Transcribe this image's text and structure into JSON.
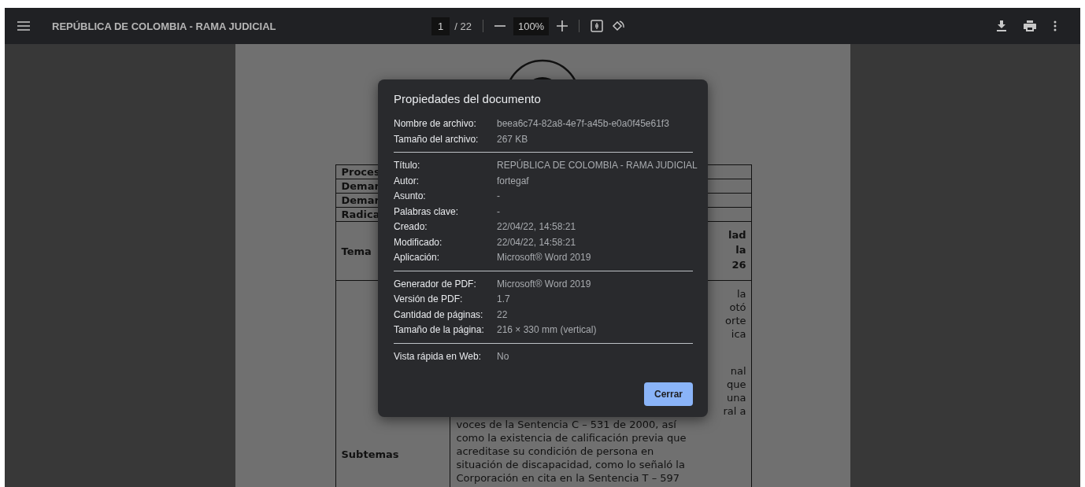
{
  "toolbar": {
    "title": "REPÚBLICA DE COLOMBIA - RAMA JUDICIAL",
    "page_input": "1",
    "page_total": "/ 22",
    "zoom": "100%"
  },
  "document": {
    "rows": [
      {
        "label": "Proces"
      },
      {
        "label": "Demar"
      },
      {
        "label": "Demar"
      },
      {
        "label": "Radica"
      },
      {
        "label": "Tema",
        "bold": true,
        "paragraphs": [
          [
            {
              "kind": "fragment",
              "text": "lad"
            },
            {
              "kind": "fragment",
              "text": "la"
            },
            {
              "kind": "fragment",
              "text": "26"
            }
          ]
        ]
      },
      {
        "label": "Subtemas",
        "bold": false,
        "paragraphs": [
          [
            {
              "kind": "fragment",
              "text": "la"
            },
            {
              "kind": "fragment",
              "text": "otó"
            },
            {
              "kind": "fragment",
              "text": "orte"
            },
            {
              "kind": "fragment",
              "text": "ica"
            }
          ],
          [
            {
              "kind": "fragment",
              "text": "nal"
            },
            {
              "kind": "fragment",
              "text": "que"
            },
            {
              "kind": "fragment",
              "text": "una"
            },
            {
              "kind": "fragment",
              "text": "ral a"
            },
            {
              "kind": "line",
              "text": "voces de la Sentencia C – 531 de 2000, así"
            },
            {
              "kind": "line",
              "text": "como la existencia de calificación previa que"
            },
            {
              "kind": "line",
              "text": "acreditase su condición de persona en"
            },
            {
              "kind": "line",
              "text": "situación de discapacidad, como lo señaló la"
            },
            {
              "kind": "line",
              "text": "Corporación en cita en la Sentencia T – 597"
            }
          ]
        ]
      }
    ]
  },
  "dialog": {
    "title": "Propiedades del documento",
    "sections": [
      [
        {
          "label": "Nombre de archivo:",
          "value": "beea6c74-82a8-4e7f-a45b-e0a0f45e61f3"
        },
        {
          "label": "Tamaño del archivo:",
          "value": "267 KB"
        }
      ],
      [
        {
          "label": "Título:",
          "value": "REPÚBLICA DE COLOMBIA - RAMA JUDICIAL"
        },
        {
          "label": "Autor:",
          "value": "fortegaf"
        },
        {
          "label": "Asunto:",
          "value": "-"
        },
        {
          "label": "Palabras clave:",
          "value": "-"
        },
        {
          "label": "Creado:",
          "value": "22/04/22, 14:58:21"
        },
        {
          "label": "Modificado:",
          "value": "22/04/22, 14:58:21"
        },
        {
          "label": "Aplicación:",
          "value": "Microsoft® Word 2019"
        }
      ],
      [
        {
          "label": "Generador de PDF:",
          "value": "Microsoft® Word 2019"
        },
        {
          "label": "Versión de PDF:",
          "value": "1.7"
        },
        {
          "label": "Cantidad de páginas:",
          "value": "22"
        },
        {
          "label": "Tamaño de la página:",
          "value": "216 × 330 mm (vertical)"
        }
      ],
      [
        {
          "label": "Vista rápida en Web:",
          "value": "No"
        }
      ]
    ],
    "button": "Cerrar"
  }
}
